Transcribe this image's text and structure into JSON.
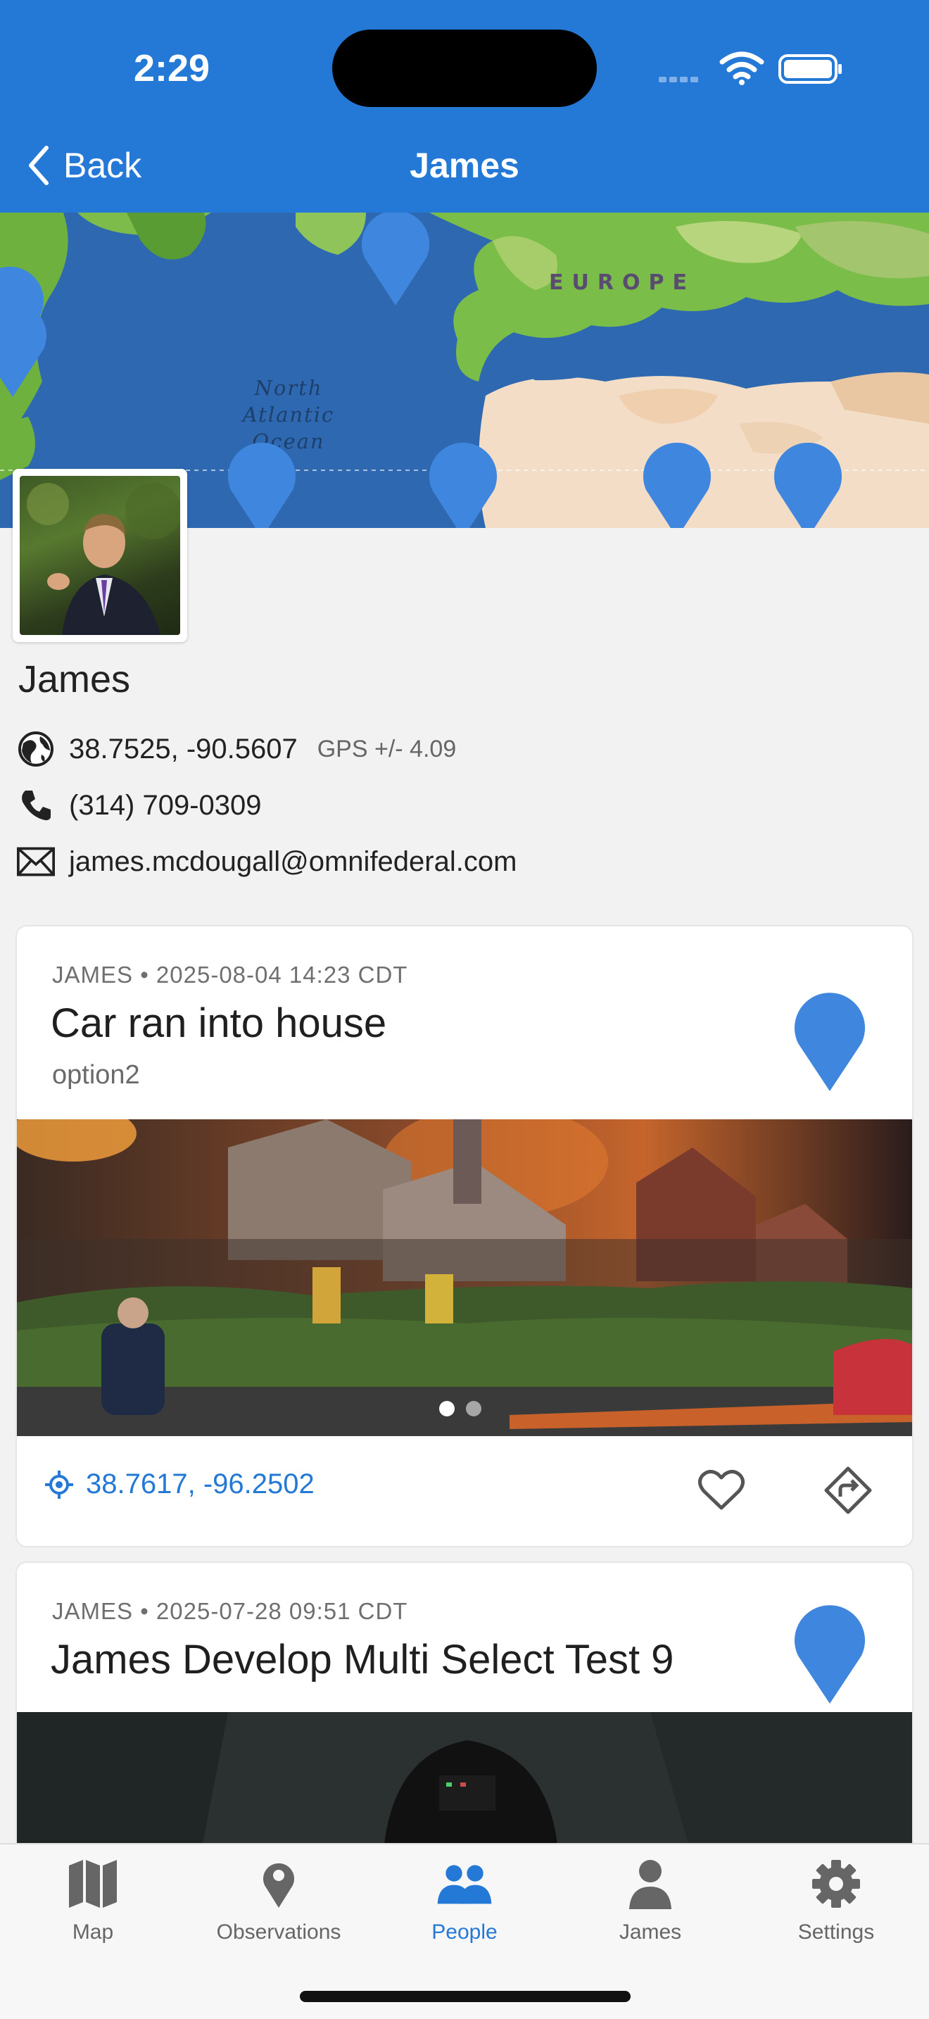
{
  "status_bar": {
    "time": "2:29"
  },
  "nav": {
    "back_label": "Back",
    "title": "James"
  },
  "map": {
    "labels": {
      "europe": "EUROPE",
      "ocean_line1": "North",
      "ocean_line2": "Atlantic",
      "ocean_line3": "Ocean"
    },
    "pin_color": "#3f86de"
  },
  "profile": {
    "name": "James",
    "coordinates": "38.7525, -90.5607",
    "gps_accuracy": "GPS +/- 4.09",
    "phone": "(314) 709-0309",
    "email": "james.mcdougall@omnifederal.com"
  },
  "observations": [
    {
      "meta": "JAMES • 2025-08-04 14:23 CDT",
      "title": "Car ran into house",
      "subtitle": "option2",
      "location": "38.7617, -96.2502",
      "photo_pages": 2,
      "current_page": 1
    },
    {
      "meta": "JAMES • 2025-07-28 09:51 CDT",
      "title": "James Develop Multi Select Test 9"
    }
  ],
  "tabs": [
    {
      "label": "Map",
      "icon": "map-icon"
    },
    {
      "label": "Observations",
      "icon": "location-pin-icon"
    },
    {
      "label": "People",
      "icon": "people-icon",
      "active": true
    },
    {
      "label": "James",
      "icon": "person-icon"
    },
    {
      "label": "Settings",
      "icon": "gear-icon"
    }
  ],
  "colors": {
    "accent": "#2479d6",
    "header_bg": "#2479d6"
  }
}
